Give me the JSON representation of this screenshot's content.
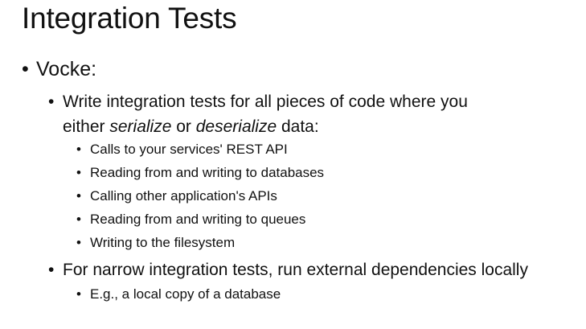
{
  "slide": {
    "title": "Integration Tests",
    "bullet_char": "•",
    "level1": {
      "text": "Vocke:"
    },
    "point_serialize": {
      "line1": "Write integration tests for all pieces of code where you",
      "line2_pre": "either ",
      "line2_em1": "serialize",
      "line2_mid": " or ",
      "line2_em2": "deserialize",
      "line2_post": " data:",
      "subitems": [
        "Calls to your services' REST API",
        "Reading from and writing to databases",
        "Calling other application's APIs",
        "Reading from and writing to queues",
        "Writing to the filesystem"
      ]
    },
    "point_narrow": {
      "text": "For narrow integration tests, run external dependencies locally",
      "subitems": [
        "E.g., a local copy of a database"
      ]
    }
  }
}
